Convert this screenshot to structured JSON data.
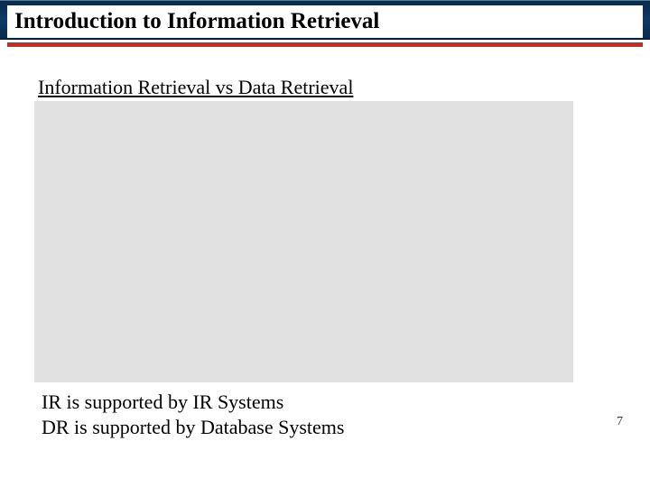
{
  "header": {
    "title": "Introduction to Information Retrieval"
  },
  "content": {
    "subtitle": "Information Retrieval vs Data Retrieval",
    "line1": "IR is supported by IR Systems",
    "line2": "DR is supported by Database Systems"
  },
  "footer": {
    "page_number": "7"
  }
}
